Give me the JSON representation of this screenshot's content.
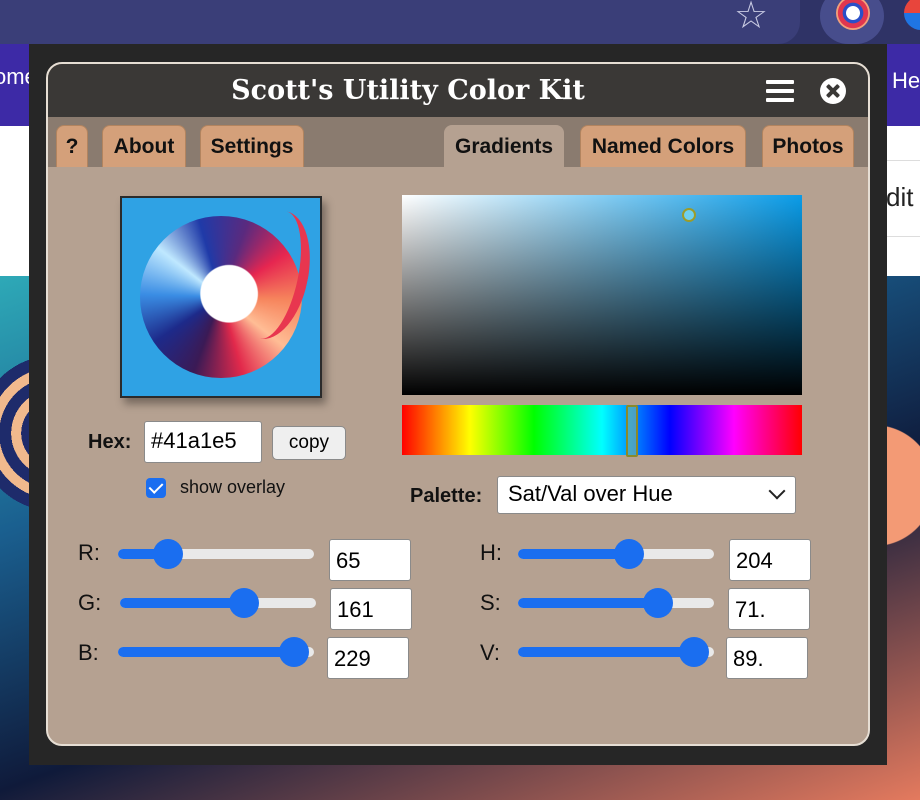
{
  "browser": {
    "nav_left_text": "ome",
    "nav_right_text": "He",
    "page_right_text": "dit"
  },
  "popup": {
    "title": "Scott's Utility Color Kit",
    "tabs": [
      {
        "label": "?"
      },
      {
        "label": "About"
      },
      {
        "label": "Settings"
      },
      {
        "label": "Gradients"
      },
      {
        "label": "Named Colors"
      },
      {
        "label": "Photos"
      }
    ],
    "active_tab": "Gradients"
  },
  "color": {
    "hex_label": "Hex:",
    "hex_value": "#41a1e5",
    "copy_label": "copy",
    "show_overlay_label": "show overlay",
    "show_overlay_checked": true,
    "accent": "#1a6ef0"
  },
  "palette": {
    "label": "Palette:",
    "selected": "Sat/Val over Hue"
  },
  "rgb": {
    "r_label": "R:",
    "r_value": "65",
    "g_label": "G:",
    "g_value": "161",
    "b_label": "B:",
    "b_value": "229",
    "r_level": 0.255,
    "g_level": 0.631,
    "b_level": 0.898
  },
  "hsv": {
    "h_label": "H:",
    "h_value": "204",
    "s_label": "S:",
    "s_value": "71.",
    "v_label": "V:",
    "v_value": "89.",
    "h_level": 0.567,
    "s_level": 0.716,
    "v_level": 0.898
  }
}
